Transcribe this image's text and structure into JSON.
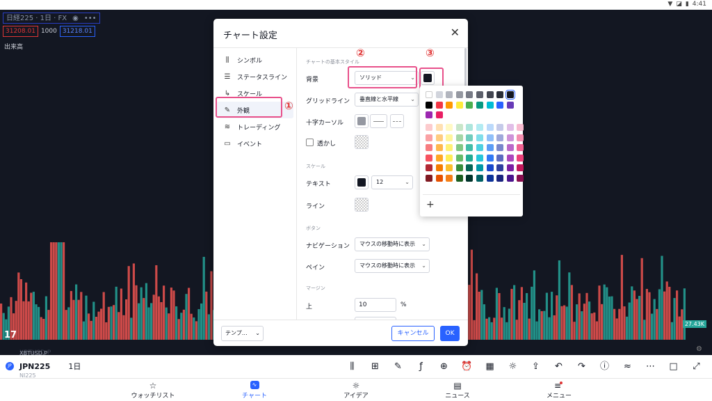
{
  "status_bar": {
    "time": "4:41"
  },
  "chart": {
    "symbol_title": "日経225 · 1日 · FX",
    "bid": "31208.01",
    "spread": "1000",
    "ask": "31218.01",
    "volume_label": "出来高",
    "volume_badge": "27.43K",
    "ghost_symbol": "XBTUSD.P",
    "colors": {
      "up": "#26a69a",
      "down": "#ef5350",
      "background": "#131722"
    }
  },
  "toolbar": {
    "symbol": "JPN225",
    "flag": "JP",
    "interval": "1日",
    "ghost_top": "XBTUSD.P",
    "ghost_bottom": "NI225"
  },
  "bottom_nav": {
    "watchlist": "ウォッチリスト",
    "chart": "チャート",
    "ideas": "アイデア",
    "news": "ニュース",
    "menu": "メニュー"
  },
  "dialog": {
    "title": "チャート設定",
    "sidebar": [
      {
        "label": "シンボル",
        "icon": "candles-icon"
      },
      {
        "label": "ステータスライン",
        "icon": "status-line-icon"
      },
      {
        "label": "スケール",
        "icon": "scale-icon"
      },
      {
        "label": "外観",
        "icon": "pencil-icon"
      },
      {
        "label": "トレーディング",
        "icon": "trading-icon"
      },
      {
        "label": "イベント",
        "icon": "calendar-icon"
      }
    ],
    "section_basic": "チャートの基本スタイル",
    "background_label": "背景",
    "background_value": "ソリッド",
    "background_color": "#131722",
    "grid_label": "グリッドライン",
    "grid_value": "垂直線と水平線",
    "crosshair_label": "十字カーソル",
    "crosshair_color": "#9598a1",
    "watermark_label": "透かし",
    "section_scale": "スケール",
    "text_label": "テキスト",
    "text_color": "#131722",
    "text_size": "12",
    "line_label": "ライン",
    "section_buttons": "ボタン",
    "navigation_label": "ナビゲーション",
    "navigation_value": "マウスの移動時に表示",
    "pane_label": "ペイン",
    "pane_value": "マウスの移動時に表示",
    "section_margin": "マージン",
    "top_label": "上",
    "top_value": "10",
    "top_unit": "%",
    "template_label": "テンプ…",
    "cancel_label": "キャンセル",
    "ok_label": "OK"
  },
  "annotations": {
    "one": "①",
    "two": "②",
    "three": "③"
  },
  "palette": {
    "grays": [
      "#ffffff",
      "#d1d4dc",
      "#b2b5be",
      "#9598a1",
      "#787b86",
      "#5d606b",
      "#434651",
      "#2a2e39",
      "#131722"
    ],
    "mains": [
      "#000000",
      "#f23645",
      "#ff9800",
      "#ffeb3b",
      "#4caf50",
      "#089981",
      "#00bcd4",
      "#2962ff",
      "#673ab7",
      "#9c27b0",
      "#e91e63"
    ],
    "shades": [
      [
        "#fccbcd",
        "#ffe0b2",
        "#fff9c4",
        "#c8e6c9",
        "#ace5dc",
        "#b2ebf2",
        "#bbd9fb",
        "#c5cae9",
        "#e1bee7",
        "#f8bbd0"
      ],
      [
        "#faa1a4",
        "#ffcc80",
        "#fff59d",
        "#a5d6a7",
        "#70ccbd",
        "#80deea",
        "#90bff9",
        "#9fa8da",
        "#ce93d8",
        "#f48fb1"
      ],
      [
        "#f77c80",
        "#ffb74d",
        "#fff176",
        "#81c784",
        "#42bda8",
        "#4dd0e1",
        "#5b9cf6",
        "#7986cb",
        "#ba68c8",
        "#f06292"
      ],
      [
        "#f7525f",
        "#ffa726",
        "#ffee58",
        "#66bb6a",
        "#22ab94",
        "#26c6da",
        "#3179f5",
        "#5c6bc0",
        "#ab47bc",
        "#ec407a"
      ],
      [
        "#b22833",
        "#f57c00",
        "#fbc02d",
        "#388e3c",
        "#056656",
        "#0097a7",
        "#1848cc",
        "#303f9f",
        "#7b1fa2",
        "#c2185b"
      ],
      [
        "#801922",
        "#e65100",
        "#f57f17",
        "#1b5e20",
        "#00332a",
        "#006064",
        "#0c3299",
        "#1a237e",
        "#4a148c",
        "#880e4f"
      ]
    ]
  }
}
